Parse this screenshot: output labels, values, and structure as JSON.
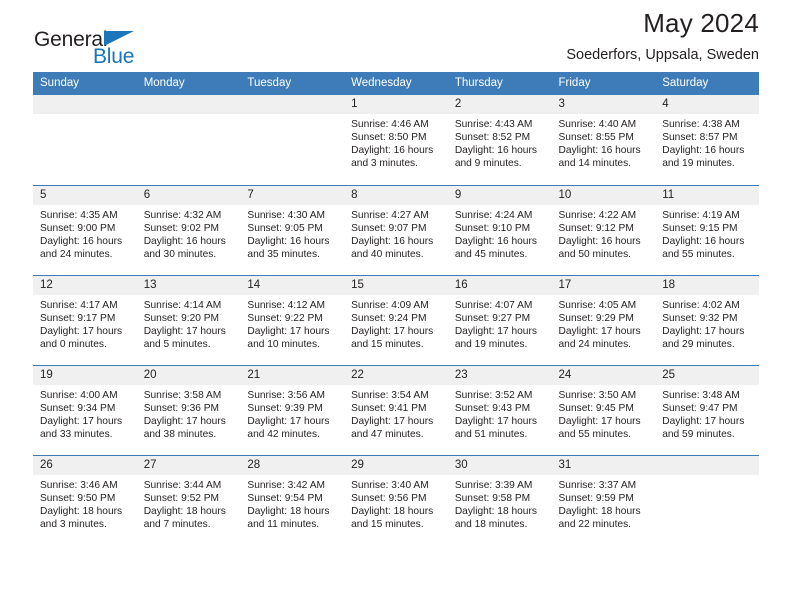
{
  "brand": {
    "name_part1": "General",
    "name_part2": "Blue",
    "colors": {
      "blue": "#1a75bb",
      "dark": "#231f20"
    }
  },
  "header": {
    "title": "May 2024",
    "subtitle": "Soederfors, Uppsala, Sweden",
    "header_bg": "#3d7cb8",
    "daynum_bg": "#f0f0f0"
  },
  "weekday_headers": [
    "Sunday",
    "Monday",
    "Tuesday",
    "Wednesday",
    "Thursday",
    "Friday",
    "Saturday"
  ],
  "labels": {
    "sunrise": "Sunrise:",
    "sunset": "Sunset:",
    "daylight": "Daylight:"
  },
  "weeks": [
    [
      {
        "day": "",
        "empty": true,
        "sunrise": "",
        "sunset": "",
        "daylight_line1": "",
        "daylight_line2": ""
      },
      {
        "day": "",
        "empty": true,
        "sunrise": "",
        "sunset": "",
        "daylight_line1": "",
        "daylight_line2": ""
      },
      {
        "day": "",
        "empty": true,
        "sunrise": "",
        "sunset": "",
        "daylight_line1": "",
        "daylight_line2": ""
      },
      {
        "day": "1",
        "empty": false,
        "sunrise": "Sunrise: 4:46 AM",
        "sunset": "Sunset: 8:50 PM",
        "daylight_line1": "Daylight: 16 hours",
        "daylight_line2": "and 3 minutes."
      },
      {
        "day": "2",
        "empty": false,
        "sunrise": "Sunrise: 4:43 AM",
        "sunset": "Sunset: 8:52 PM",
        "daylight_line1": "Daylight: 16 hours",
        "daylight_line2": "and 9 minutes."
      },
      {
        "day": "3",
        "empty": false,
        "sunrise": "Sunrise: 4:40 AM",
        "sunset": "Sunset: 8:55 PM",
        "daylight_line1": "Daylight: 16 hours",
        "daylight_line2": "and 14 minutes."
      },
      {
        "day": "4",
        "empty": false,
        "sunrise": "Sunrise: 4:38 AM",
        "sunset": "Sunset: 8:57 PM",
        "daylight_line1": "Daylight: 16 hours",
        "daylight_line2": "and 19 minutes."
      }
    ],
    [
      {
        "day": "5",
        "empty": false,
        "sunrise": "Sunrise: 4:35 AM",
        "sunset": "Sunset: 9:00 PM",
        "daylight_line1": "Daylight: 16 hours",
        "daylight_line2": "and 24 minutes."
      },
      {
        "day": "6",
        "empty": false,
        "sunrise": "Sunrise: 4:32 AM",
        "sunset": "Sunset: 9:02 PM",
        "daylight_line1": "Daylight: 16 hours",
        "daylight_line2": "and 30 minutes."
      },
      {
        "day": "7",
        "empty": false,
        "sunrise": "Sunrise: 4:30 AM",
        "sunset": "Sunset: 9:05 PM",
        "daylight_line1": "Daylight: 16 hours",
        "daylight_line2": "and 35 minutes."
      },
      {
        "day": "8",
        "empty": false,
        "sunrise": "Sunrise: 4:27 AM",
        "sunset": "Sunset: 9:07 PM",
        "daylight_line1": "Daylight: 16 hours",
        "daylight_line2": "and 40 minutes."
      },
      {
        "day": "9",
        "empty": false,
        "sunrise": "Sunrise: 4:24 AM",
        "sunset": "Sunset: 9:10 PM",
        "daylight_line1": "Daylight: 16 hours",
        "daylight_line2": "and 45 minutes."
      },
      {
        "day": "10",
        "empty": false,
        "sunrise": "Sunrise: 4:22 AM",
        "sunset": "Sunset: 9:12 PM",
        "daylight_line1": "Daylight: 16 hours",
        "daylight_line2": "and 50 minutes."
      },
      {
        "day": "11",
        "empty": false,
        "sunrise": "Sunrise: 4:19 AM",
        "sunset": "Sunset: 9:15 PM",
        "daylight_line1": "Daylight: 16 hours",
        "daylight_line2": "and 55 minutes."
      }
    ],
    [
      {
        "day": "12",
        "empty": false,
        "sunrise": "Sunrise: 4:17 AM",
        "sunset": "Sunset: 9:17 PM",
        "daylight_line1": "Daylight: 17 hours",
        "daylight_line2": "and 0 minutes."
      },
      {
        "day": "13",
        "empty": false,
        "sunrise": "Sunrise: 4:14 AM",
        "sunset": "Sunset: 9:20 PM",
        "daylight_line1": "Daylight: 17 hours",
        "daylight_line2": "and 5 minutes."
      },
      {
        "day": "14",
        "empty": false,
        "sunrise": "Sunrise: 4:12 AM",
        "sunset": "Sunset: 9:22 PM",
        "daylight_line1": "Daylight: 17 hours",
        "daylight_line2": "and 10 minutes."
      },
      {
        "day": "15",
        "empty": false,
        "sunrise": "Sunrise: 4:09 AM",
        "sunset": "Sunset: 9:24 PM",
        "daylight_line1": "Daylight: 17 hours",
        "daylight_line2": "and 15 minutes."
      },
      {
        "day": "16",
        "empty": false,
        "sunrise": "Sunrise: 4:07 AM",
        "sunset": "Sunset: 9:27 PM",
        "daylight_line1": "Daylight: 17 hours",
        "daylight_line2": "and 19 minutes."
      },
      {
        "day": "17",
        "empty": false,
        "sunrise": "Sunrise: 4:05 AM",
        "sunset": "Sunset: 9:29 PM",
        "daylight_line1": "Daylight: 17 hours",
        "daylight_line2": "and 24 minutes."
      },
      {
        "day": "18",
        "empty": false,
        "sunrise": "Sunrise: 4:02 AM",
        "sunset": "Sunset: 9:32 PM",
        "daylight_line1": "Daylight: 17 hours",
        "daylight_line2": "and 29 minutes."
      }
    ],
    [
      {
        "day": "19",
        "empty": false,
        "sunrise": "Sunrise: 4:00 AM",
        "sunset": "Sunset: 9:34 PM",
        "daylight_line1": "Daylight: 17 hours",
        "daylight_line2": "and 33 minutes."
      },
      {
        "day": "20",
        "empty": false,
        "sunrise": "Sunrise: 3:58 AM",
        "sunset": "Sunset: 9:36 PM",
        "daylight_line1": "Daylight: 17 hours",
        "daylight_line2": "and 38 minutes."
      },
      {
        "day": "21",
        "empty": false,
        "sunrise": "Sunrise: 3:56 AM",
        "sunset": "Sunset: 9:39 PM",
        "daylight_line1": "Daylight: 17 hours",
        "daylight_line2": "and 42 minutes."
      },
      {
        "day": "22",
        "empty": false,
        "sunrise": "Sunrise: 3:54 AM",
        "sunset": "Sunset: 9:41 PM",
        "daylight_line1": "Daylight: 17 hours",
        "daylight_line2": "and 47 minutes."
      },
      {
        "day": "23",
        "empty": false,
        "sunrise": "Sunrise: 3:52 AM",
        "sunset": "Sunset: 9:43 PM",
        "daylight_line1": "Daylight: 17 hours",
        "daylight_line2": "and 51 minutes."
      },
      {
        "day": "24",
        "empty": false,
        "sunrise": "Sunrise: 3:50 AM",
        "sunset": "Sunset: 9:45 PM",
        "daylight_line1": "Daylight: 17 hours",
        "daylight_line2": "and 55 minutes."
      },
      {
        "day": "25",
        "empty": false,
        "sunrise": "Sunrise: 3:48 AM",
        "sunset": "Sunset: 9:47 PM",
        "daylight_line1": "Daylight: 17 hours",
        "daylight_line2": "and 59 minutes."
      }
    ],
    [
      {
        "day": "26",
        "empty": false,
        "sunrise": "Sunrise: 3:46 AM",
        "sunset": "Sunset: 9:50 PM",
        "daylight_line1": "Daylight: 18 hours",
        "daylight_line2": "and 3 minutes."
      },
      {
        "day": "27",
        "empty": false,
        "sunrise": "Sunrise: 3:44 AM",
        "sunset": "Sunset: 9:52 PM",
        "daylight_line1": "Daylight: 18 hours",
        "daylight_line2": "and 7 minutes."
      },
      {
        "day": "28",
        "empty": false,
        "sunrise": "Sunrise: 3:42 AM",
        "sunset": "Sunset: 9:54 PM",
        "daylight_line1": "Daylight: 18 hours",
        "daylight_line2": "and 11 minutes."
      },
      {
        "day": "29",
        "empty": false,
        "sunrise": "Sunrise: 3:40 AM",
        "sunset": "Sunset: 9:56 PM",
        "daylight_line1": "Daylight: 18 hours",
        "daylight_line2": "and 15 minutes."
      },
      {
        "day": "30",
        "empty": false,
        "sunrise": "Sunrise: 3:39 AM",
        "sunset": "Sunset: 9:58 PM",
        "daylight_line1": "Daylight: 18 hours",
        "daylight_line2": "and 18 minutes."
      },
      {
        "day": "31",
        "empty": false,
        "sunrise": "Sunrise: 3:37 AM",
        "sunset": "Sunset: 9:59 PM",
        "daylight_line1": "Daylight: 18 hours",
        "daylight_line2": "and 22 minutes."
      },
      {
        "day": "",
        "empty": true,
        "sunrise": "",
        "sunset": "",
        "daylight_line1": "",
        "daylight_line2": ""
      }
    ]
  ]
}
